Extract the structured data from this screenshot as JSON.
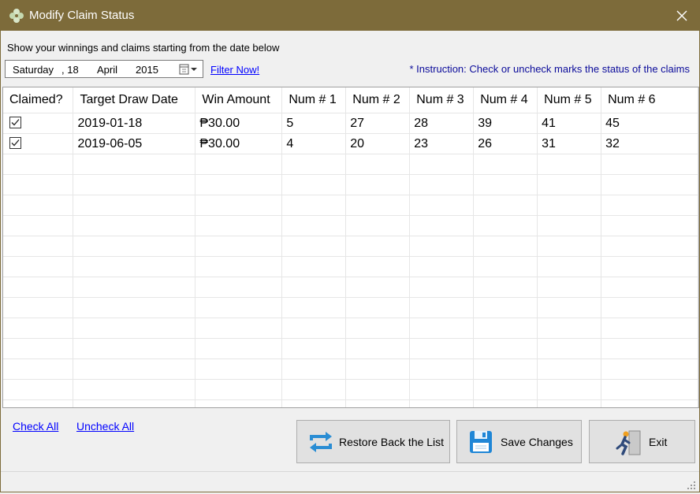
{
  "window": {
    "title": "Modify Claim Status",
    "accent": "#7d6b3a"
  },
  "filter": {
    "description": "Show your winnings and claims starting from the date below",
    "date": {
      "weekday": "Saturday",
      "day": ", 18",
      "month": "April",
      "year": "2015"
    },
    "filter_link": "Filter Now!",
    "instruction": "* Instruction: Check or uncheck marks the status of the claims"
  },
  "grid": {
    "columns": [
      "Claimed?",
      "Target Draw Date",
      "Win Amount",
      "Num # 1",
      "Num # 2",
      "Num # 3",
      "Num # 4",
      "Num # 5",
      "Num # 6"
    ],
    "rows": [
      {
        "claimed": true,
        "date": "2019-01-18",
        "amount": "₱30.00",
        "n1": "5",
        "n2": "27",
        "n3": "28",
        "n4": "39",
        "n5": "41",
        "n6": "45"
      },
      {
        "claimed": true,
        "date": "2019-06-05",
        "amount": "₱30.00",
        "n1": "4",
        "n2": "20",
        "n3": "23",
        "n4": "26",
        "n5": "31",
        "n6": "32"
      }
    ]
  },
  "actions": {
    "check_all": "Check All",
    "uncheck_all": "Uncheck All",
    "restore": "Restore Back the List",
    "save": "Save Changes",
    "exit": "Exit"
  }
}
